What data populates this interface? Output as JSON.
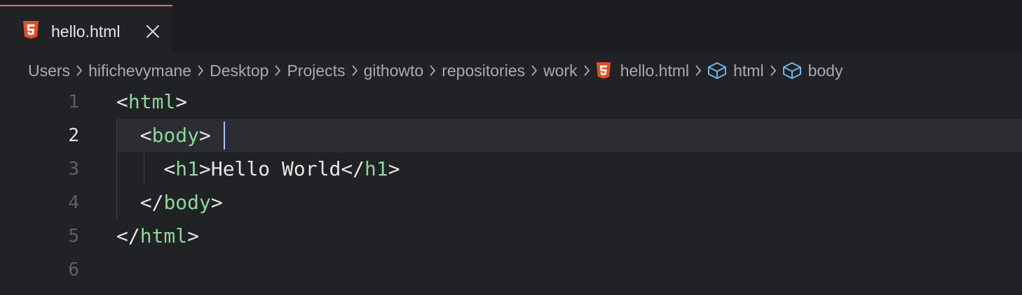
{
  "tab": {
    "label": "hello.html",
    "icon": "html5-icon",
    "close_icon": "close-icon"
  },
  "breadcrumb": {
    "items": [
      {
        "label": "Users"
      },
      {
        "label": "hifichevymane"
      },
      {
        "label": "Desktop"
      },
      {
        "label": "Projects"
      },
      {
        "label": "githowto"
      },
      {
        "label": "repositories"
      },
      {
        "label": "work"
      },
      {
        "label": "hello.html",
        "icon": "html5-icon"
      },
      {
        "label": "html",
        "icon": "cube-icon"
      },
      {
        "label": "body",
        "icon": "cube-icon"
      }
    ],
    "separator_icon": "chevron-right-icon"
  },
  "editor": {
    "active_line": 2,
    "lines": [
      {
        "number": "1",
        "indent": "",
        "open": "<",
        "tag": "html",
        "close": ">",
        "rest": ""
      },
      {
        "number": "2",
        "indent": "  ",
        "open": "<",
        "tag": "body",
        "close": ">",
        "rest": ""
      },
      {
        "number": "3",
        "indent": "    ",
        "open": "<",
        "tag": "h1",
        "close": ">",
        "text": "Hello World",
        "end_open": "</",
        "end_tag": "h1",
        "end_close": ">"
      },
      {
        "number": "4",
        "indent": "  ",
        "open": "</",
        "tag": "body",
        "close": ">",
        "rest": ""
      },
      {
        "number": "5",
        "indent": "",
        "open": "</",
        "tag": "html",
        "close": ">",
        "rest": ""
      },
      {
        "number": "6"
      }
    ]
  },
  "colors": {
    "background": "#212226",
    "tab_bar": "#1b1c1f",
    "tab_accent": "#e0725a",
    "tag_name": "#8ed69a",
    "html5_orange": "#e34f26",
    "cube_blue": "#6fb3e8",
    "cursor": "#a9c4ff"
  }
}
